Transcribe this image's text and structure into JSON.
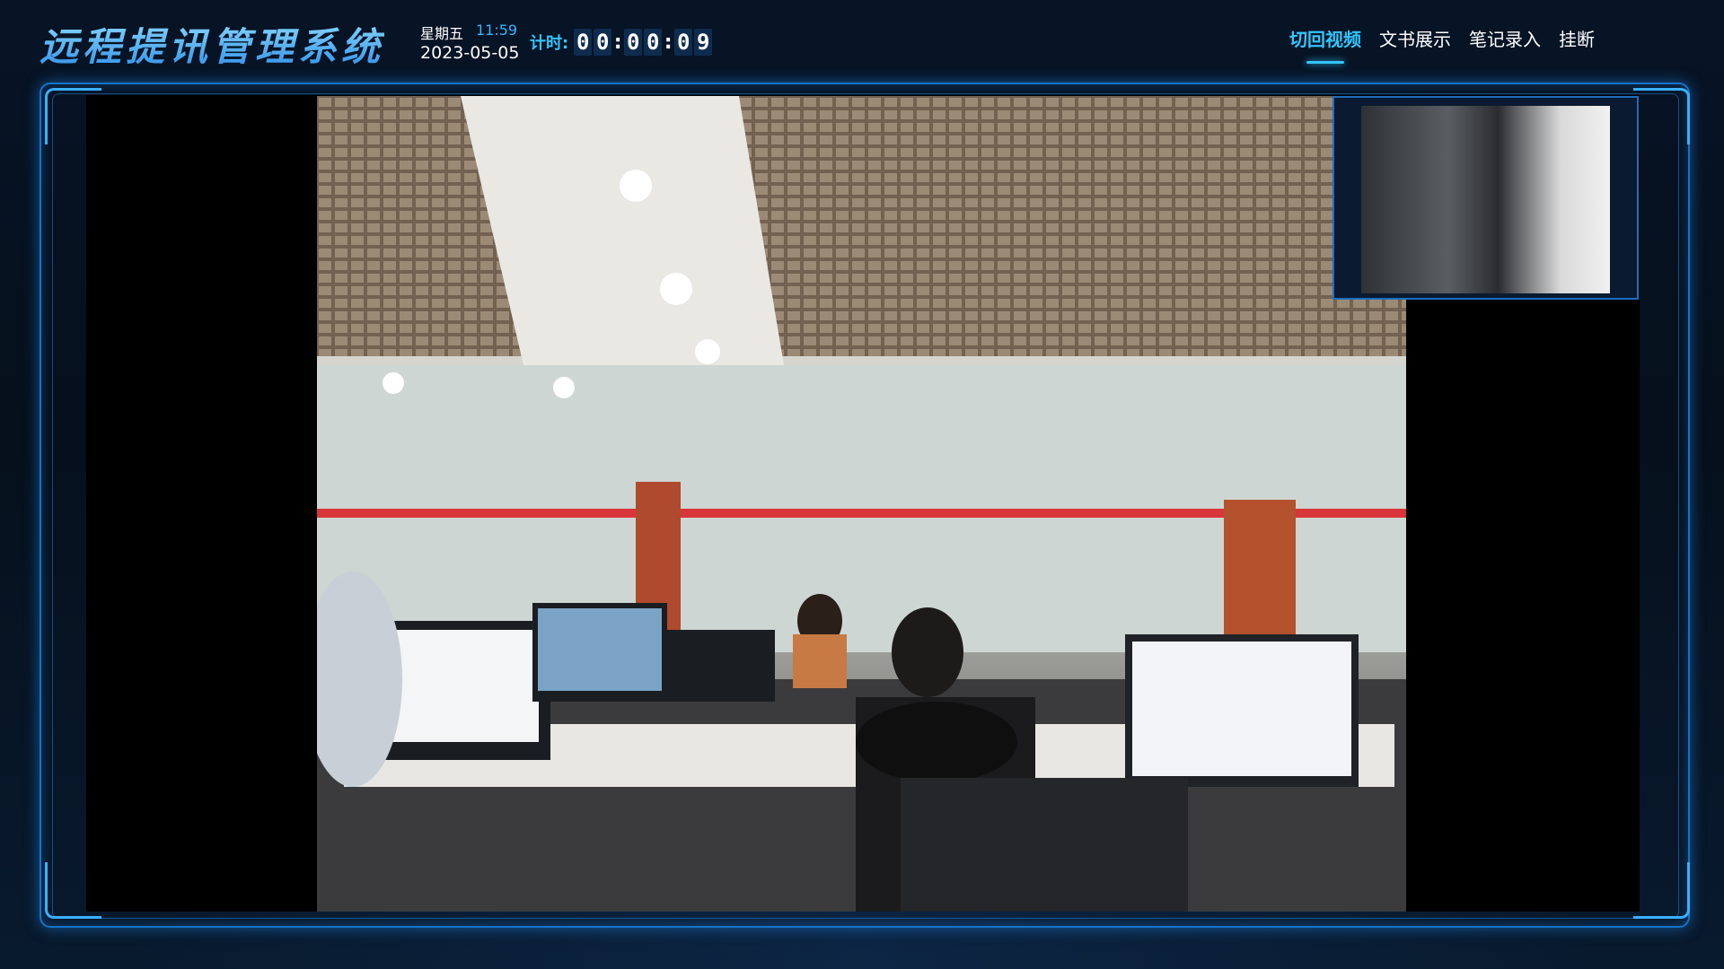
{
  "header": {
    "app_title": "远程提讯管理系统",
    "weekday": "星期五",
    "time": "11:59",
    "date": "2023-05-05",
    "timer_label": "计时:",
    "timer_digits": [
      "0",
      "0",
      "0",
      "0",
      "0",
      "9"
    ]
  },
  "nav": {
    "items": [
      {
        "label": "切回视频",
        "active": true
      },
      {
        "label": "文书展示",
        "active": false
      },
      {
        "label": "笔记录入",
        "active": false
      },
      {
        "label": "挂断",
        "active": false
      }
    ]
  },
  "colors": {
    "accent": "#33c6ff",
    "frame_border": "#1673c8",
    "background": "#06101c"
  }
}
